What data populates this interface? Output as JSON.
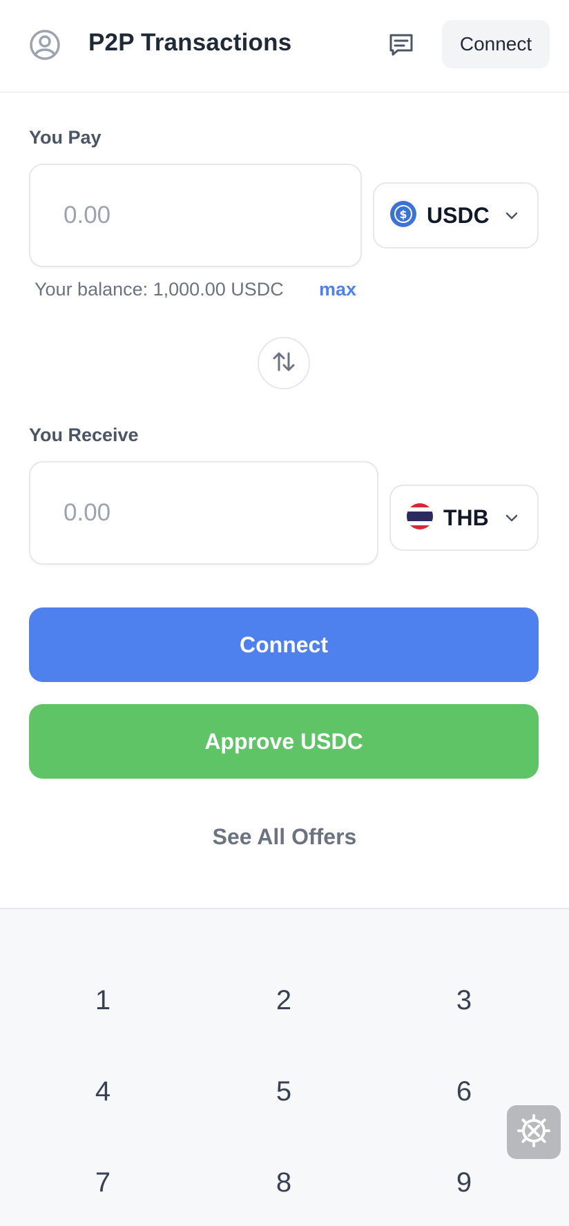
{
  "header": {
    "title": "P2P Transactions",
    "connect_label": "Connect",
    "avatar_icon": "user-circle-icon",
    "chat_icon": "chat-icon"
  },
  "pay": {
    "label": "You Pay",
    "placeholder": "0.00",
    "currency": "USDC",
    "currency_icon": "usdc-coin-icon",
    "balance_text": "Your balance: 1,000.00 USDC",
    "max_label": "max"
  },
  "swap_icon": "swap-arrows-icon",
  "receive": {
    "label": "You Receive",
    "placeholder": "0.00",
    "currency": "THB",
    "currency_icon": "thailand-flag-icon"
  },
  "actions": {
    "connect_label": "Connect",
    "approve_label": "Approve USDC",
    "offers_label": "See All Offers"
  },
  "keypad": {
    "keys": [
      "1",
      "2",
      "3",
      "4",
      "5",
      "6",
      "7",
      "8",
      "9"
    ]
  },
  "settings_icon": "settings-gear-icon",
  "colors": {
    "primary": "#4f81ee",
    "success": "#5ec466",
    "muted_text": "#6b7280",
    "keypad_bg": "#f7f8fa"
  }
}
